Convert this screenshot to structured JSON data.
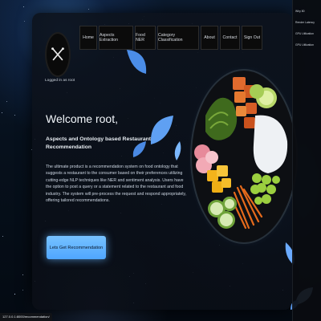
{
  "nav": {
    "items": [
      {
        "label": "Home"
      },
      {
        "label": "Aspects Extraction"
      },
      {
        "label": "Food NER"
      },
      {
        "label": "Category Classification"
      },
      {
        "label": "About"
      },
      {
        "label": "Contact"
      },
      {
        "label": "Sign Out"
      }
    ]
  },
  "user": {
    "logged_in_text": "Logged in as root"
  },
  "hero": {
    "title": "Welcome root,",
    "subtitle": "Aspects and Ontology based Restaurants Recommendation",
    "body": "The ultimate product is a recommendation system on food ontology that suggests a restaurant to the consumer based on their preferences utilizing cutting-edge NLP techniques like NER and sentiment analysis. Users have the option to post a query or a statement related to the restaurant and food industry. The system will pre-process the request and respond appropriately, offering tailored recommendations.",
    "cta_label": "Lets Get Recommendation"
  },
  "side_menu": {
    "items": [
      {
        "label": "Why 80"
      },
      {
        "label": "Render Latency"
      },
      {
        "label": "GPU Utilization"
      },
      {
        "label": "GPU Utilization"
      }
    ]
  },
  "status_bar": {
    "url": "127.0.0.1:8000/recommendation/"
  },
  "colors": {
    "accent": "#5aaeff",
    "background": "#03070d",
    "panel": "#0c121c"
  },
  "icons": {
    "logo": "fork-knife-icon"
  }
}
